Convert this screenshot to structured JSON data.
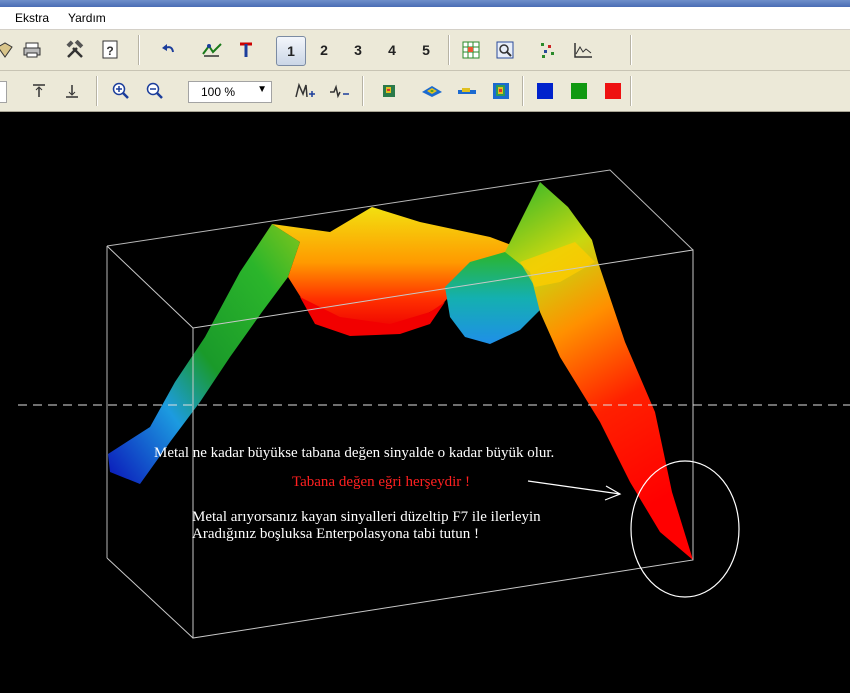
{
  "menu": {
    "items": [
      "Ekstra",
      "Yardım"
    ]
  },
  "toolbar1": {
    "pages": [
      "1",
      "2",
      "3",
      "4",
      "5"
    ],
    "active_page": "1"
  },
  "toolbar2": {
    "zoom_value": "100 %",
    "colors": {
      "blue": "#0022cc",
      "green": "#119911",
      "red": "#ee1111"
    }
  },
  "scene": {
    "line1": "Metal ne kadar büyükse tabana değen sinyalde o kadar büyük olur.",
    "line2": "Tabana değen eğri herşeydir !",
    "line3": "Metal arıyorsanız kayan sinyalleri düzeltip F7 ile ilerleyin",
    "line4": "Aradığınız boşluksa Enterpolasyona tabi tutun !"
  },
  "icons": [
    "open-icon",
    "print-icon",
    "tools-icon",
    "help-icon",
    "undo-icon",
    "filter-icon",
    "marker-icon",
    "grid-icon",
    "preview-icon",
    "scatter-icon",
    "graph-icon",
    "align-top-icon",
    "align-bottom-icon",
    "zoom-in-icon",
    "zoom-out-icon",
    "add-marker-icon",
    "remove-marker-icon",
    "map-view-icon",
    "surface-view-icon",
    "profile-view-icon",
    "color-map-icon"
  ]
}
